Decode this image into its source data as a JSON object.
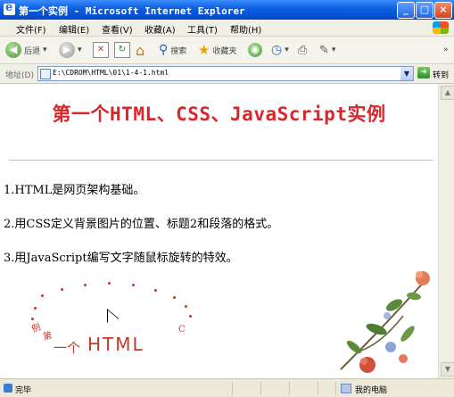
{
  "window": {
    "title": "第一个实例 - Microsoft Internet Explorer",
    "controls": [
      "_",
      "□",
      "×"
    ]
  },
  "menu": {
    "items": [
      "文件(F)",
      "编辑(E)",
      "查看(V)",
      "收藏(A)",
      "工具(T)",
      "帮助(H)"
    ]
  },
  "toolbar": {
    "back_label": "后退",
    "search_label": "搜索",
    "favorites_label": "收藏夹"
  },
  "address": {
    "label": "地址(D)",
    "url": "E:\\CDROM\\HTML\\01\\1-4-1.html",
    "go_label": "转到"
  },
  "content": {
    "title": "第一个HTML、CSS、JavaScript实例",
    "items": [
      "1.HTML是网页架构基础。",
      "2.用CSS定义背景图片的位置、标题2和段落的格式。",
      "3.用JavaScript编写文字随鼠标旋转的特效。"
    ],
    "trail_text": [
      "例",
      "第",
      "一个",
      "HTML",
      "C"
    ]
  },
  "status": {
    "text": "完毕",
    "zone": "我的电脑"
  },
  "colors": {
    "title_red": "#d8262a",
    "titlebar_blue": "#0a5fe0"
  }
}
